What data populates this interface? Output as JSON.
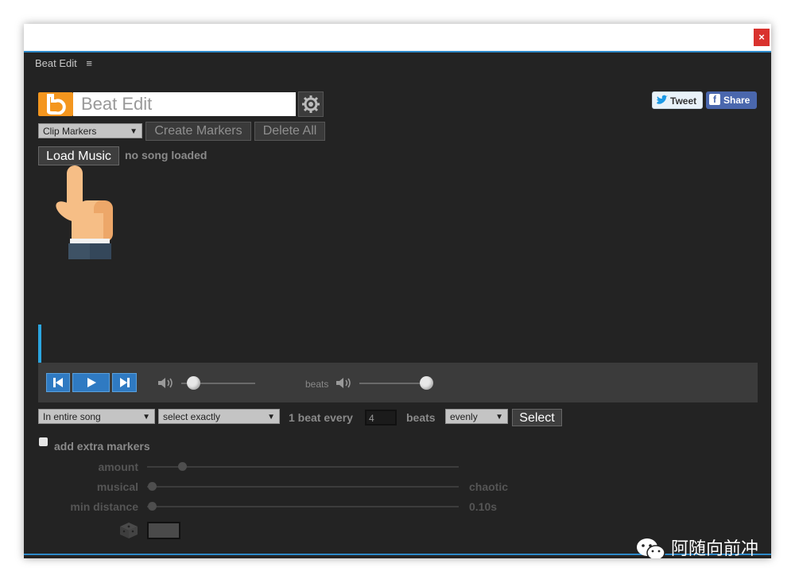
{
  "window": {
    "close_label": "×"
  },
  "panel": {
    "title": "Beat Edit",
    "menu_icon": "≡"
  },
  "logo": {
    "letter": "b",
    "title_text": "Beat Edit",
    "accent": "#f4961e"
  },
  "social": {
    "tweet_label": "Tweet",
    "share_label": "Share",
    "share_fb": "f"
  },
  "toolbar": {
    "marker_type": "Clip Markers",
    "create_label": "Create Markers",
    "delete_label": "Delete All"
  },
  "music": {
    "load_label": "Load Music",
    "status": "no song loaded"
  },
  "transport": {
    "beats_label": "beats"
  },
  "select_row": {
    "range_option": "In entire song",
    "mode_option": "select exactly",
    "beat_every_label": "1 beat every",
    "beat_count": "4",
    "beats_label": "beats",
    "distribution_option": "evenly",
    "select_label": "Select"
  },
  "extra": {
    "checkbox_label": "add extra markers",
    "amount_label": "amount",
    "musical_label": "musical",
    "chaotic_label": "chaotic",
    "min_distance_label": "min distance",
    "min_distance_value": "0.10s"
  },
  "watermark": {
    "text": "阿随向前冲"
  }
}
